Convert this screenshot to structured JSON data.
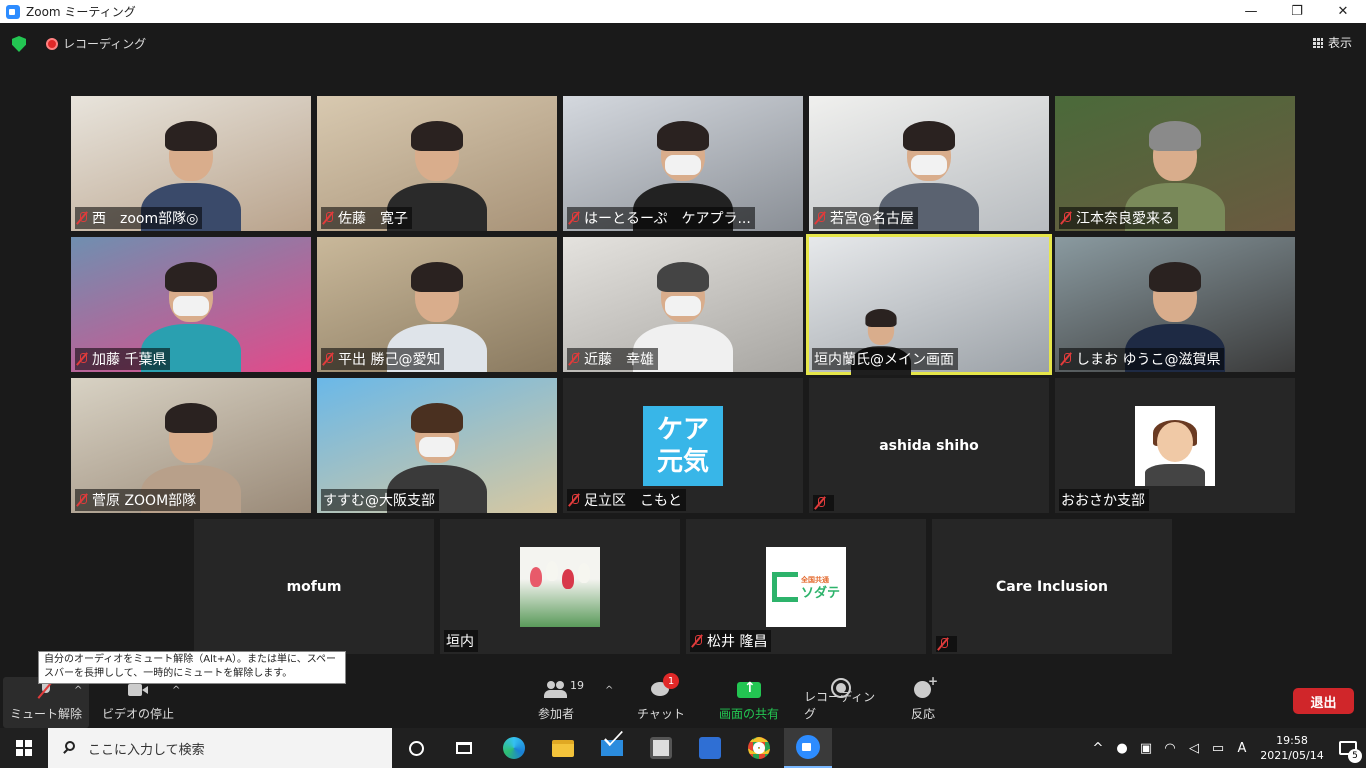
{
  "window": {
    "title": "Zoom ミーティング",
    "minimize": "—",
    "maximize": "❐",
    "close": "✕"
  },
  "meeting_bar": {
    "recording_label": "レコーディング",
    "view_label": "表示"
  },
  "tiles": [
    {
      "name": "西　zoom部隊◎",
      "muted": true
    },
    {
      "name": "佐藤　寛子",
      "muted": true
    },
    {
      "name": "はーとるーぷ　ケアプラ...",
      "muted": true
    },
    {
      "name": "若宮@名古屋",
      "muted": true
    },
    {
      "name": "江本奈良愛来る",
      "muted": true
    },
    {
      "name": "加藤 千葉県",
      "muted": true
    },
    {
      "name": "平出 勝己@愛知",
      "muted": true
    },
    {
      "name": "近藤　幸雄",
      "muted": true
    },
    {
      "name": "垣内蘭氏@メイン画面",
      "muted": false,
      "active": true
    },
    {
      "name": "しまお ゆうこ@滋賀県",
      "muted": true
    },
    {
      "name": "菅原 ZOOM部隊",
      "muted": true
    },
    {
      "name": "すすむ@大阪支部",
      "muted": false
    },
    {
      "name": "足立区　こもと",
      "muted": true,
      "logo_text_1": "ケア",
      "logo_text_2": "元気"
    },
    {
      "name": "ashida shiho",
      "muted": true
    },
    {
      "name": "おおさか支部",
      "muted": false
    },
    {
      "name": "mofum",
      "muted": false
    },
    {
      "name": "垣内",
      "muted": false
    },
    {
      "name": "松井 隆昌",
      "muted": true,
      "logo_small": "全国共通",
      "logo_main": "ソダテ"
    },
    {
      "name": "Care Inclusion",
      "muted": true
    }
  ],
  "tooltip": {
    "text": "自分のオーディオをミュート解除（Alt+A）。または単に、スペースバーを長押しして、一時的にミュートを解除します。"
  },
  "toolbar": {
    "mute_label": "ミュート解除",
    "video_label": "ビデオの停止",
    "participants_label": "参加者",
    "participants_count": "19",
    "chat_label": "チャット",
    "chat_badge": "1",
    "share_label": "画面の共有",
    "record_label": "レコーディング",
    "reactions_label": "反応",
    "leave_label": "退出",
    "caret": "^"
  },
  "taskbar": {
    "search_placeholder": "ここに入力して検索",
    "time": "19:58",
    "date": "2021/05/14",
    "ime": "A",
    "notification_count": "5",
    "tray_caret": "^"
  },
  "colors": {
    "accent_green": "#23c552",
    "leave_red": "#d0262a",
    "active_border": "#e6e64a"
  }
}
